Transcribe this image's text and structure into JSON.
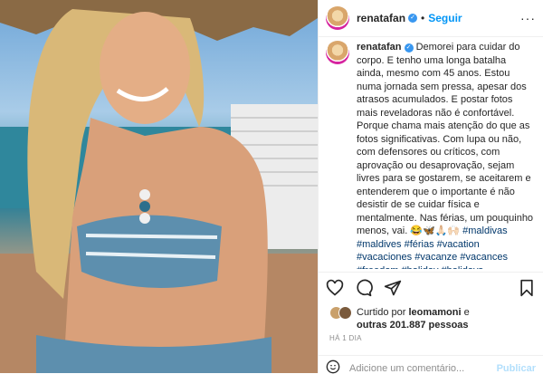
{
  "header": {
    "username": "renatafan",
    "dot": "•",
    "follow_label": "Seguir",
    "more": "···"
  },
  "caption": {
    "username": "renatafan",
    "text": "Demorei para cuidar do corpo. E tenho uma longa batalha ainda, mesmo com 45 anos. Estou numa jornada sem pressa, apesar dos atrasos acumulados. E postar fotos mais reveladoras não é confortável. Porque chama mais atenção do que as fotos significativas. Com lupa ou não, com defensores ou críticos, com aprovação ou desaprovação, sejam livres para se gostarem, se aceitarem e entenderem que o importante é não desistir de se cuidar física e mentalmente. Nas férias, um pouquinho menos, vai. 😂🦋🙏🏻🙌🏻",
    "hashtags": "#maldivas #maldives #férias #vacation #vacaciones #vacanze #vacances #freedom #holiday #holidays"
  },
  "likes": {
    "prefix": "Curtido por",
    "user": "leomamoni",
    "suffix": "e",
    "others": "outras 201.887 pessoas"
  },
  "timestamp": "HÁ 1 DIA",
  "comment": {
    "placeholder": "Adicione um comentário...",
    "publish_label": "Publicar"
  },
  "colors": {
    "accent": "#0095f6",
    "text": "#262626",
    "muted": "#8e8e8e"
  },
  "icons": [
    "verified-icon",
    "more-icon",
    "heart-icon",
    "comment-icon",
    "share-icon",
    "bookmark-icon",
    "emoji-icon"
  ]
}
